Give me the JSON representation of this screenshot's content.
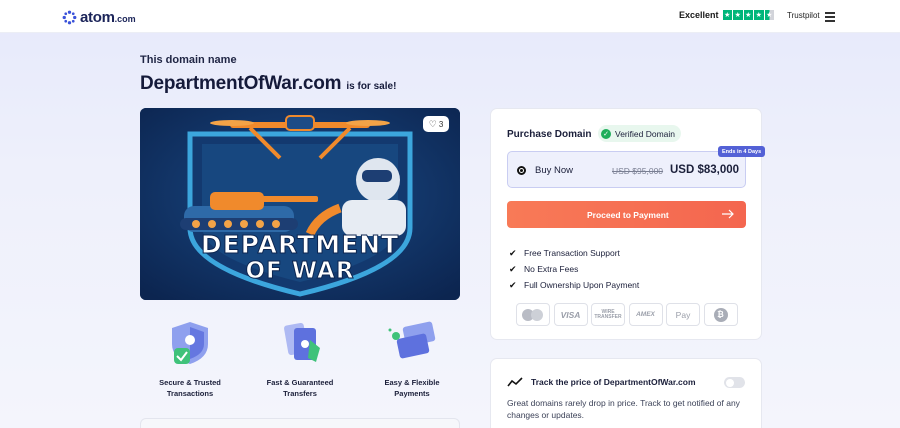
{
  "header": {
    "logo_word": "atom",
    "logo_tld": ".com",
    "trustpilot_rating_label": "Excellent",
    "trustpilot_stars": 4.5,
    "trustpilot_brand": "Trustpilot"
  },
  "listing": {
    "intro": "This domain name",
    "domain": "DepartmentOfWar.com",
    "for_sale": "is for sale!",
    "likes": "3",
    "hero_text_line1": "DEPARTMENT",
    "hero_text_line2": "OF WAR"
  },
  "features": [
    {
      "line1": "Secure & Trusted",
      "line2": "Transactions",
      "icon": "shield-check-icon"
    },
    {
      "line1": "Fast & Guaranteed",
      "line2": "Transfers",
      "icon": "file-transfer-icon"
    },
    {
      "line1": "Easy & Flexible",
      "line2": "Payments",
      "icon": "cards-icon"
    }
  ],
  "purchase": {
    "title": "Purchase Domain",
    "verified": "Verified Domain",
    "ends_badge": "Ends in 4 Days",
    "option_label": "Buy Now",
    "old_price": "USD $95,000",
    "new_price": "USD $83,000",
    "cta": "Proceed to Payment",
    "bullets": [
      "Free Transaction Support",
      "No Extra Fees",
      "Full Ownership Upon Payment"
    ],
    "payment_methods": [
      "mastercard",
      "VISA",
      "WIRE TRANSFER",
      "AMEX",
      "Pay",
      "bitcoin"
    ]
  },
  "track": {
    "title": "Track the price of DepartmentOfWar.com",
    "body": "Great domains rarely drop in price. Track to get notified of any changes or updates.",
    "enabled": false
  },
  "colors": {
    "accent": "#f4664f",
    "brand": "#1b2459",
    "trustpilot": "#00b67a",
    "verified": "#1fae5b",
    "badge": "#5361d6"
  }
}
